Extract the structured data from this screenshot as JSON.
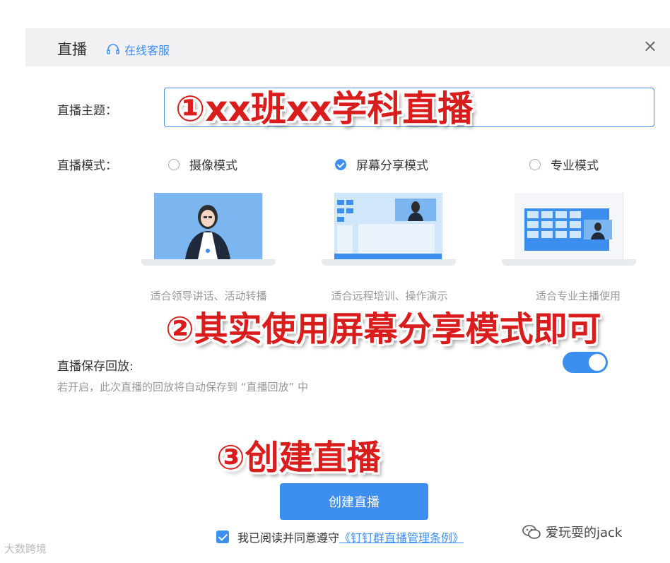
{
  "dialog": {
    "title": "直播",
    "support_label": "在线客服",
    "close_symbol": "×"
  },
  "form": {
    "topic_label": "直播主题：",
    "topic_value": "",
    "mode_label": "直播模式：",
    "modes": [
      {
        "label": "摄像模式",
        "selected": false,
        "desc": "适合领导讲话、活动转播"
      },
      {
        "label": "屏幕分享模式",
        "selected": true,
        "desc": "适合远程培训、操作演示"
      },
      {
        "label": "专业模式",
        "selected": false,
        "desc": "适合专业主播使用"
      }
    ],
    "save_label": "直播保存回放:",
    "save_hint": "若开启，此次直播的回放将自动保存到 “直播回放” 中",
    "save_enabled": true,
    "create_button": "创建直播",
    "agree_text": "我已阅读并同意遵守",
    "agree_link": "《钉钉群直播管理条例》",
    "agree_checked": true
  },
  "annotations": {
    "a1": "①xx班xx学科直播",
    "a2": "②其实使用屏幕分享模式即可",
    "a3": "③创建直播"
  },
  "watermarks": {
    "left": "大数跨境",
    "right": "爱玩耍的jack"
  },
  "colors": {
    "accent": "#3c8fef",
    "annotation": "#d91c1c",
    "header_bg": "#f1f1f3"
  },
  "icons": [
    "headset-icon",
    "close-icon",
    "wechat-icon"
  ]
}
